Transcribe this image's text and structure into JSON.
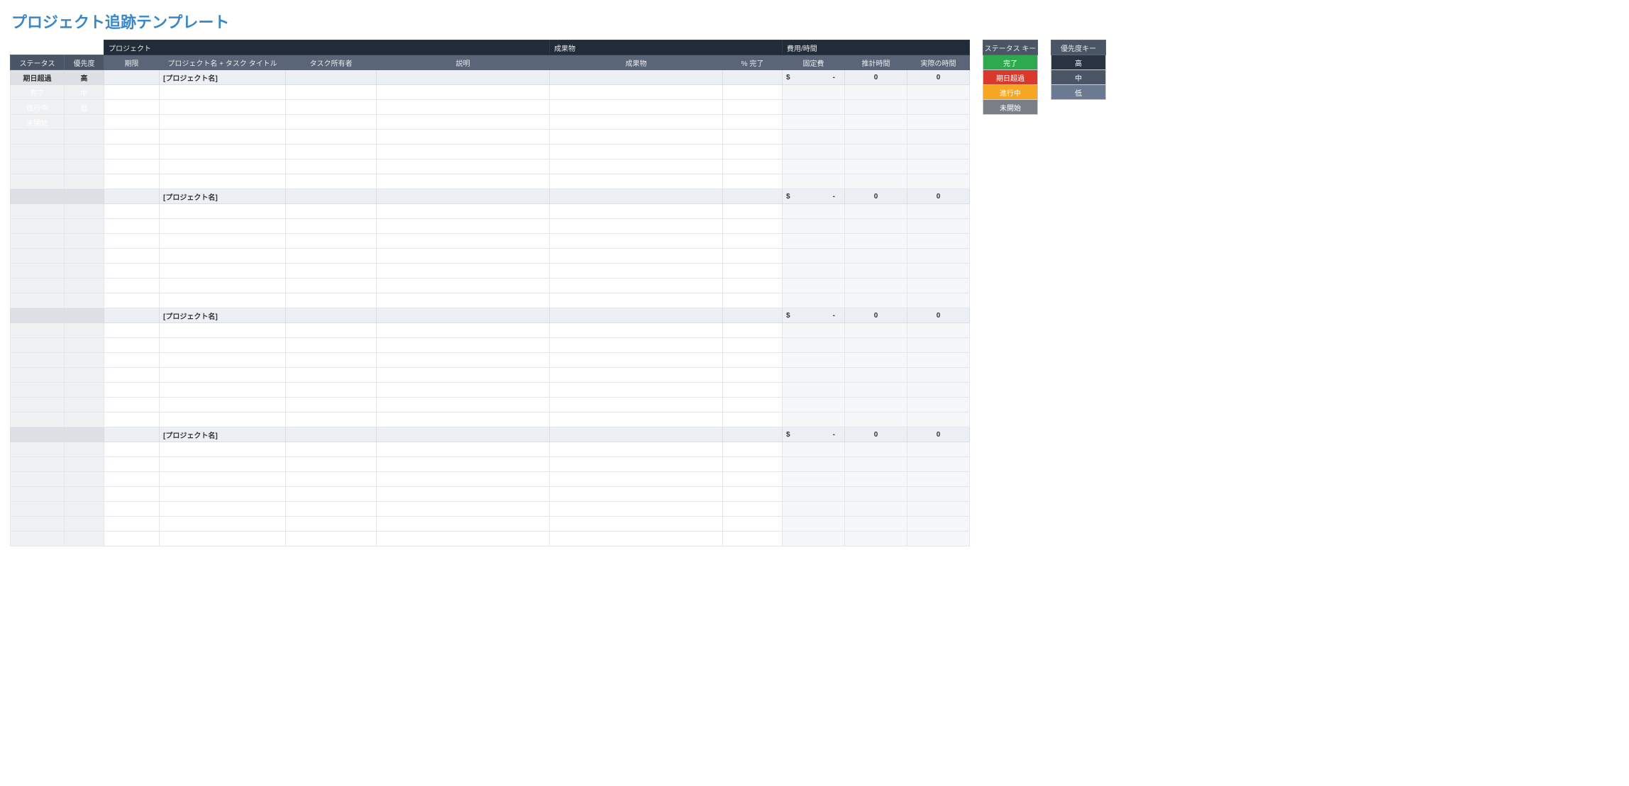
{
  "title": "プロジェクト追跡テンプレート",
  "group_headers": {
    "project": "プロジェクト",
    "deliverable": "成果物",
    "cost_time": "費用/時間"
  },
  "columns": {
    "status": "ステータス",
    "priority": "優先度",
    "deadline": "期限",
    "project_title": "プロジェクト名 + タスク タイトル",
    "owner": "タスク所有者",
    "description": "説明",
    "deliverable": "成果物",
    "pct_complete": "% 完了",
    "fixed_cost": "固定費",
    "est_hours": "推計時間",
    "act_hours": "実際の時間"
  },
  "status_labels": {
    "overdue": "期日超過",
    "done": "完了",
    "in_progress": "進行中",
    "not_started": "未開始"
  },
  "priority_labels": {
    "high": "高",
    "mid": "中",
    "low": "低"
  },
  "legend": {
    "status_key_title": "ステータス キー",
    "priority_key_title": "優先度キー"
  },
  "sections": [
    {
      "project_name": "[プロジェクト名]",
      "currency": "$",
      "cost_dash": "-",
      "est_total": "0",
      "act_total": "0"
    },
    {
      "project_name": "[プロジェクト名]",
      "currency": "$",
      "cost_dash": "-",
      "est_total": "0",
      "act_total": "0"
    },
    {
      "project_name": "[プロジェクト名]",
      "currency": "$",
      "cost_dash": "-",
      "est_total": "0",
      "act_total": "0"
    },
    {
      "project_name": "[プロジェクト名]",
      "currency": "$",
      "cost_dash": "-",
      "est_total": "0",
      "act_total": "0"
    }
  ],
  "tasks_per_section": 7,
  "left_labels_rows": [
    {
      "status": "overdue",
      "priority": "high"
    },
    {
      "status": "done",
      "priority": "mid"
    },
    {
      "status": "in_progress",
      "priority": "low"
    },
    {
      "status": "not_started",
      "priority": null
    }
  ]
}
